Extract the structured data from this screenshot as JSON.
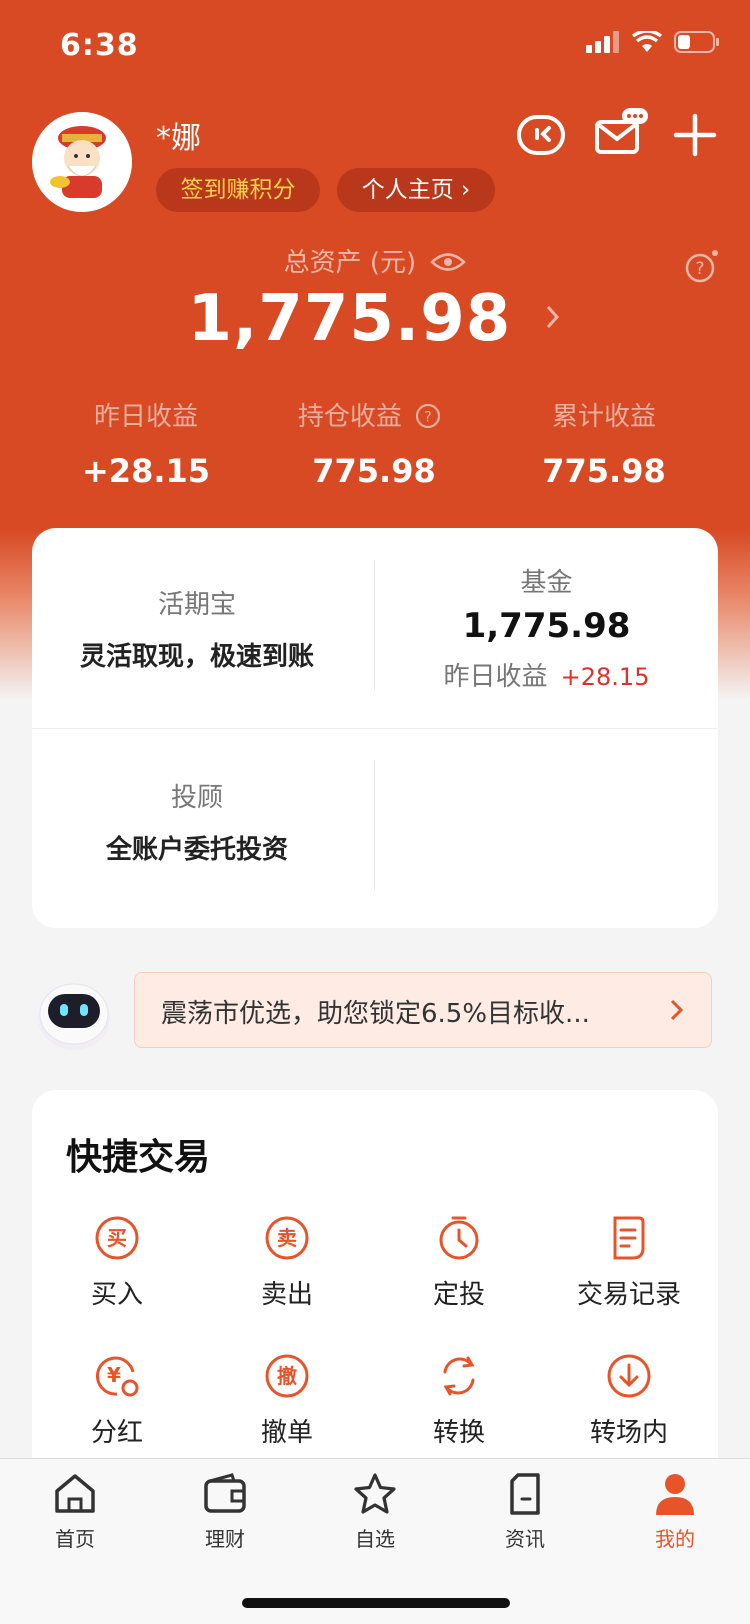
{
  "status_bar": {
    "time": "6:38"
  },
  "profile": {
    "username": "*娜",
    "signin_label": "签到赚积分",
    "homepage_label": "个人主页 ›"
  },
  "assets": {
    "total_label": "总资产 (元)",
    "total_value": "1,775.98",
    "stats": [
      {
        "label": "昨日收益",
        "value": "+28.15"
      },
      {
        "label": "持仓收益",
        "value": "775.98"
      },
      {
        "label": "累计收益",
        "value": "775.98"
      }
    ]
  },
  "products": {
    "flexible": {
      "title": "活期宝",
      "subtitle": "灵活取现，极速到账"
    },
    "fund": {
      "title": "基金",
      "value": "1,775.98",
      "yesterday_label": "昨日收益",
      "yesterday_value": "+28.15"
    },
    "advisor": {
      "title": "投顾",
      "subtitle": "全账户委托投资"
    }
  },
  "banner": {
    "text": "震荡市优选，助您锁定6.5%目标收..."
  },
  "quick_trade": {
    "title": "快捷交易",
    "items": [
      {
        "label": "买入",
        "icon": "buy-icon",
        "glyph": "买"
      },
      {
        "label": "卖出",
        "icon": "sell-icon",
        "glyph": "卖"
      },
      {
        "label": "定投",
        "icon": "timer-icon",
        "glyph": ""
      },
      {
        "label": "交易记录",
        "icon": "document-icon",
        "glyph": ""
      },
      {
        "label": "分红",
        "icon": "dividend-icon",
        "glyph": "¥"
      },
      {
        "label": "撤单",
        "icon": "cancel-order-icon",
        "glyph": "撤"
      },
      {
        "label": "转换",
        "icon": "refresh-icon",
        "glyph": ""
      },
      {
        "label": "转场内",
        "icon": "download-icon",
        "glyph": ""
      }
    ]
  },
  "tabbar": {
    "items": [
      {
        "label": "首页",
        "icon": "home-icon"
      },
      {
        "label": "理财",
        "icon": "wallet-icon"
      },
      {
        "label": "自选",
        "icon": "star-icon"
      },
      {
        "label": "资讯",
        "icon": "news-icon"
      },
      {
        "label": "我的",
        "icon": "person-icon"
      }
    ],
    "active_index": 4
  },
  "colors": {
    "brand": "#d84a24",
    "accent": "#e8542a",
    "gain": "#e0302a",
    "gold": "#ffd34d"
  }
}
